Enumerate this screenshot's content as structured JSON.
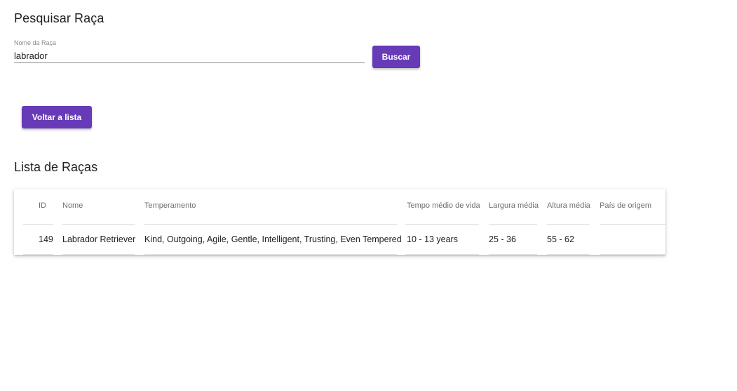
{
  "search": {
    "title": "Pesquisar Raça",
    "label": "Nome da Raça",
    "value": "labrador",
    "button_label": "Buscar"
  },
  "back_button_label": "Voltar a lista",
  "list": {
    "title": "Lista de Raças",
    "columns": {
      "id": "ID",
      "name": "Nome",
      "temperament": "Temperamento",
      "life_span": "Tempo médio de vida",
      "weight": "Largura média",
      "height": "Altura média",
      "origin": "País de origem"
    },
    "rows": [
      {
        "id": "149",
        "name": "Labrador Retriever",
        "temperament": "Kind, Outgoing, Agile, Gentle, Intelligent, Trusting, Even Tempered",
        "life_span": "10 - 13 years",
        "weight": "25 - 36",
        "height": "55 - 62",
        "origin": ""
      }
    ]
  },
  "colors": {
    "primary": "#673ab7"
  }
}
